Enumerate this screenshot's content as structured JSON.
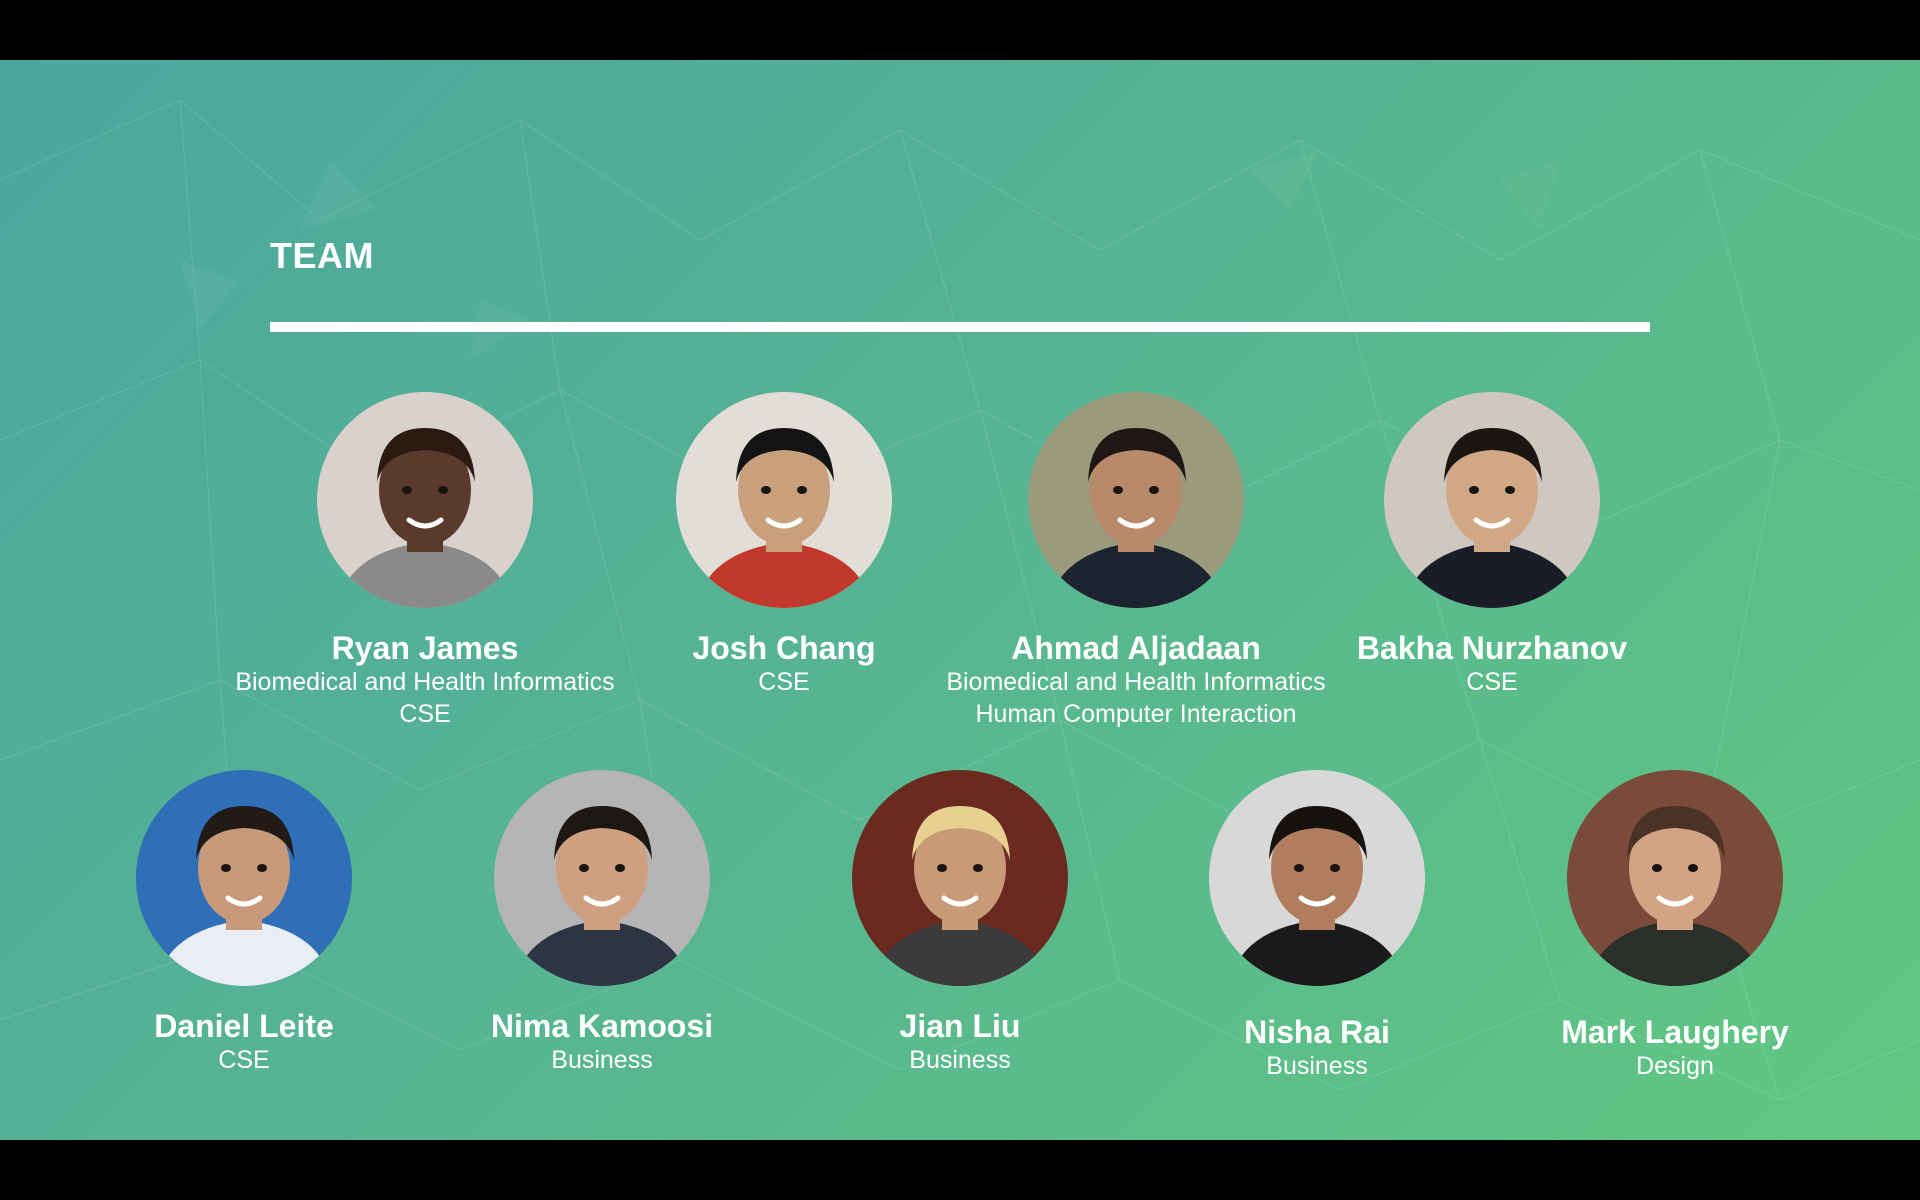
{
  "slide": {
    "title": "TEAM"
  },
  "members_row1": [
    {
      "name": "Ryan James",
      "roles": [
        "Biomedical and Health Informatics",
        "CSE"
      ],
      "bg": "#d9d2cc",
      "skin": "#5a3a2a",
      "hair": "#2a1a12",
      "shirt": "#8a8a8a"
    },
    {
      "name": "Josh Chang",
      "roles": [
        "CSE"
      ],
      "bg": "#e2ddd6",
      "skin": "#c9a07c",
      "hair": "#141414",
      "shirt": "#c0392b"
    },
    {
      "name": "Ahmad Aljadaan",
      "roles": [
        "Biomedical and Health Informatics",
        "Human Computer Interaction"
      ],
      "bg": "#9a9a7c",
      "skin": "#b88a6a",
      "hair": "#1e1714",
      "shirt": "#1c2430"
    },
    {
      "name": "Bakha Nurzhanov",
      "roles": [
        "CSE"
      ],
      "bg": "#cfc8c0",
      "skin": "#d0a886",
      "hair": "#1a1612",
      "shirt": "#1a1d28"
    }
  ],
  "members_row2": [
    {
      "name": "Daniel Leite",
      "roles": [
        "CSE"
      ],
      "bg": "#2f6fb7",
      "skin": "#c8987a",
      "hair": "#221a16",
      "shirt": "#e8eef4"
    },
    {
      "name": "Nima Kamoosi",
      "roles": [
        "Business"
      ],
      "bg": "#b5b5b5",
      "skin": "#cf9f82",
      "hair": "#1e1814",
      "shirt": "#2d3444"
    },
    {
      "name": "Jian Liu",
      "roles": [
        "Business"
      ],
      "bg": "#6a2a20",
      "skin": "#c99a78",
      "hair": "#e8d090",
      "shirt": "#3a3a3a"
    },
    {
      "name": "Nisha Rai",
      "roles": [
        "Business"
      ],
      "bg": "#d8d8d8",
      "skin": "#b07e5e",
      "hair": "#161210",
      "shirt": "#1a1a1a"
    },
    {
      "name": "Mark Laughery",
      "roles": [
        "Design"
      ],
      "bg": "#7a4a3a",
      "skin": "#d2a485",
      "hair": "#4a3224",
      "shirt": "#2a2f2a"
    }
  ]
}
